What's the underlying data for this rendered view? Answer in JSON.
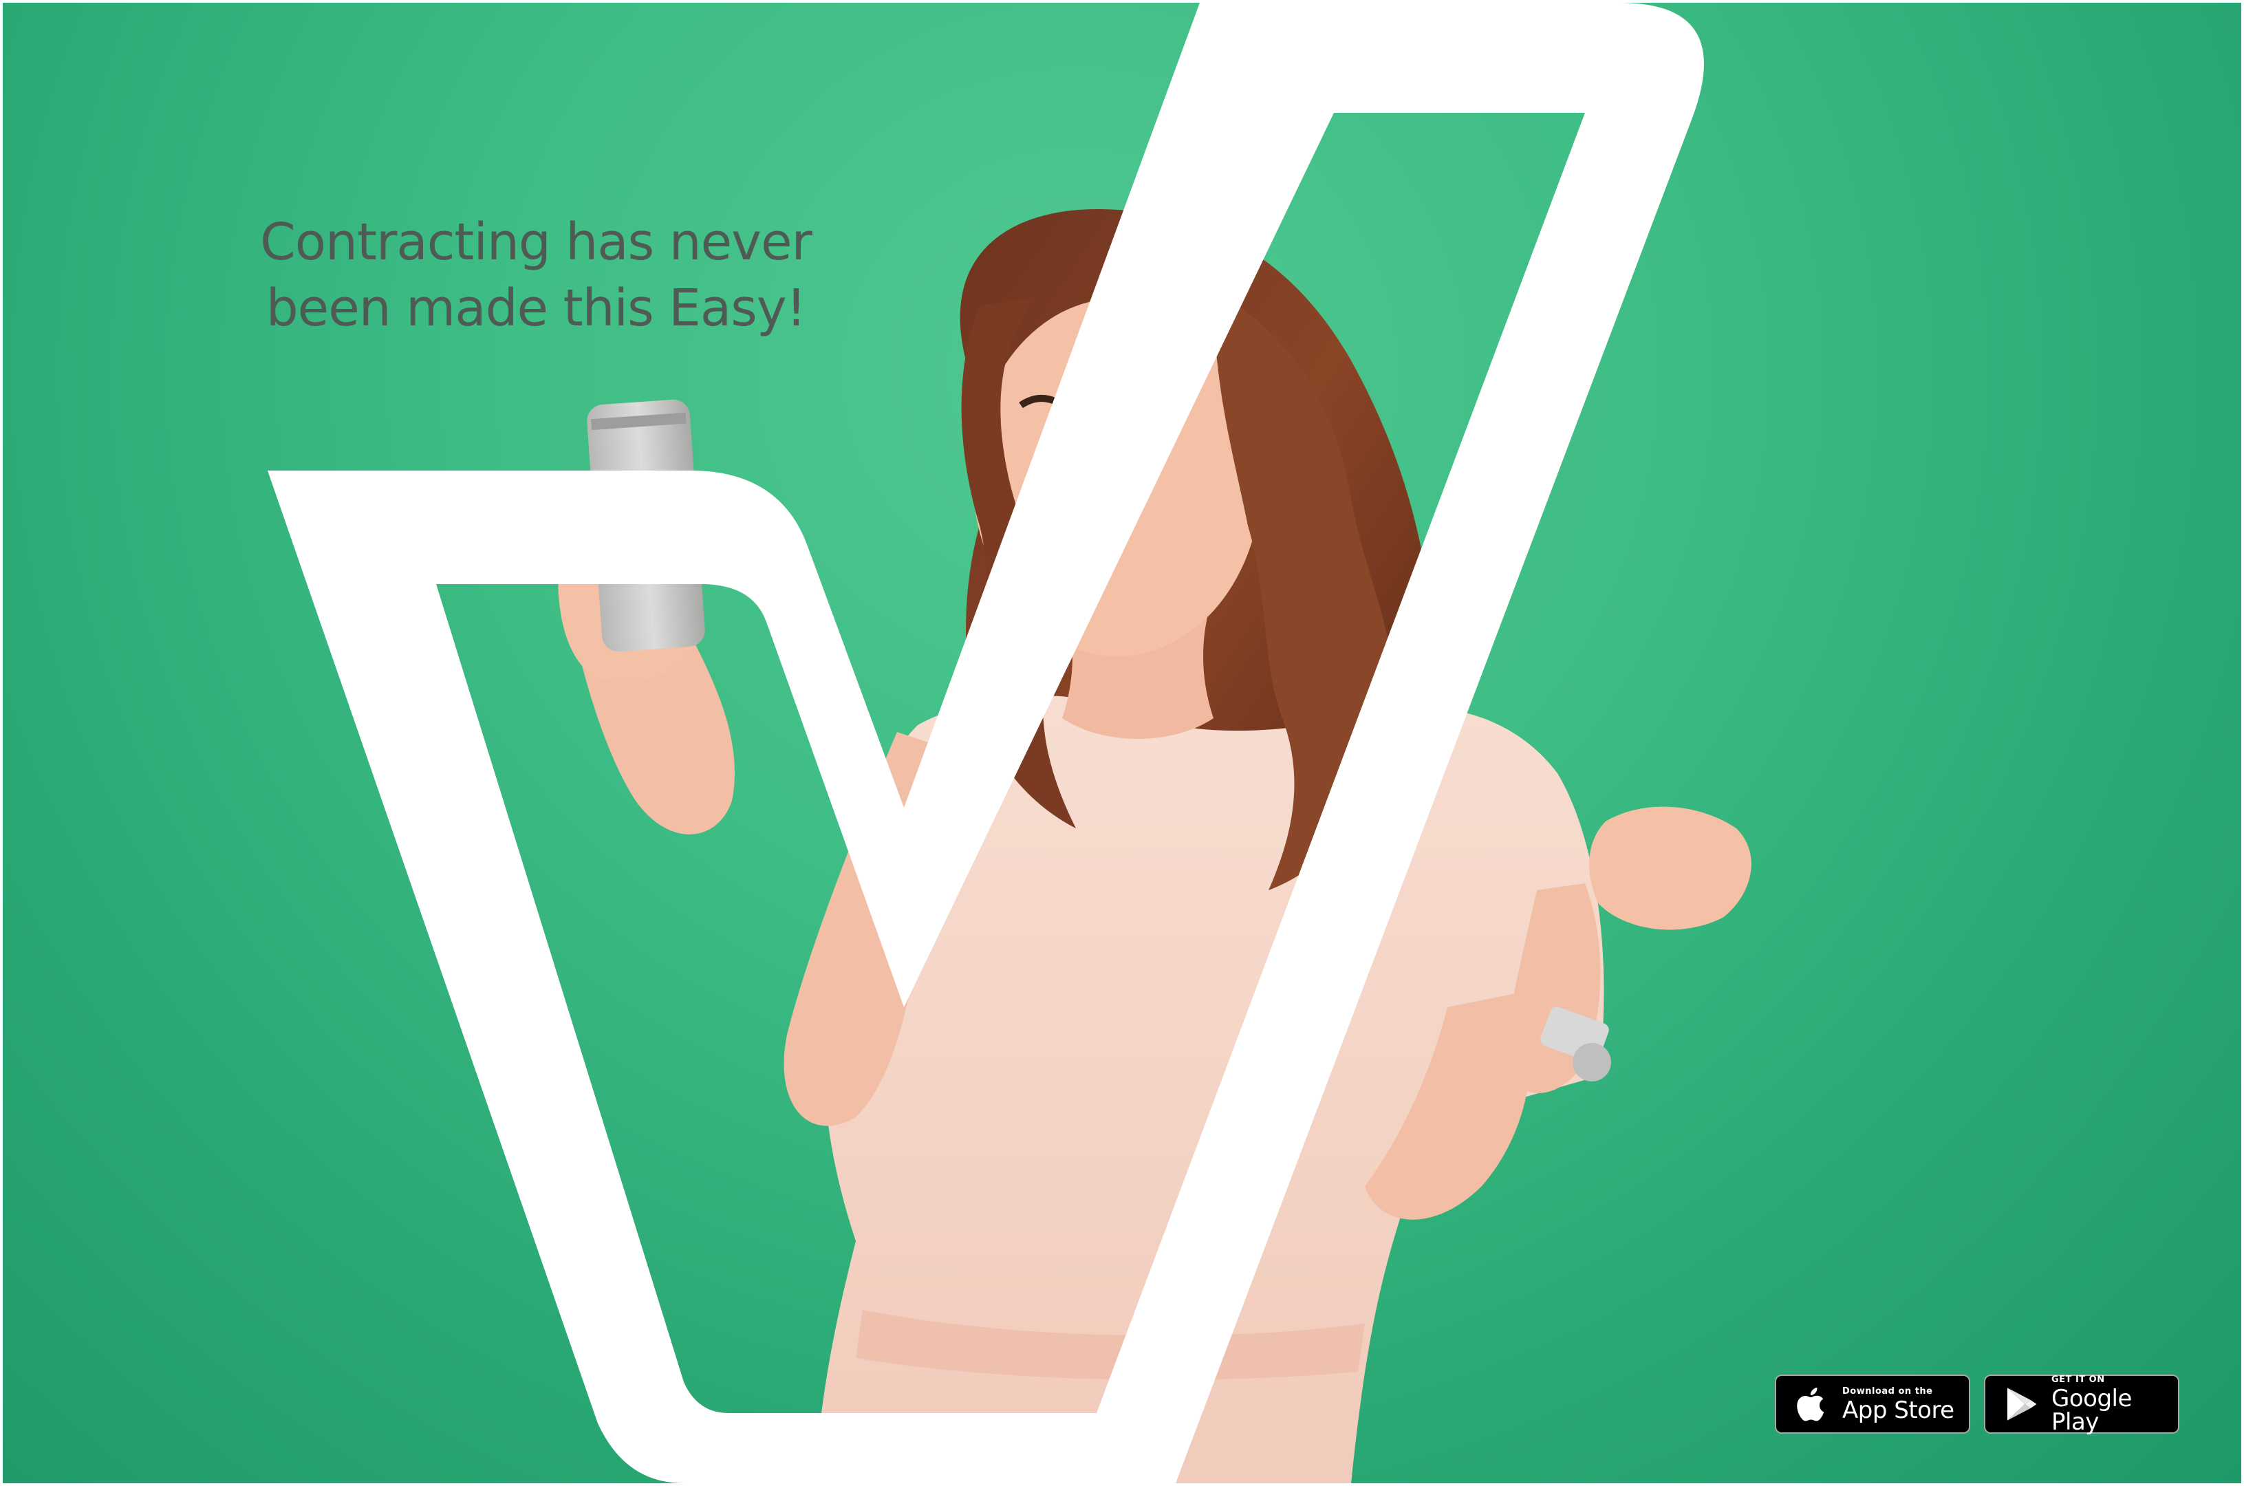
{
  "headline": {
    "line1": "Contracting has never",
    "line2": "been made this Easy!"
  },
  "badges": {
    "app_store": {
      "small_label": "Download on the",
      "big_label": "App Store",
      "icon": "apple-icon"
    },
    "google_play": {
      "small_label": "GET IT ON",
      "big_label": "Google Play",
      "icon": "google-play-icon"
    }
  },
  "colors": {
    "background_green": "#3ebd85",
    "logo_white": "#ffffff",
    "headline_text": "#4f5a54",
    "badge_black": "#000000"
  },
  "hero_image": "woman-cheering-with-phone",
  "logo": "check-mark-v-logo"
}
